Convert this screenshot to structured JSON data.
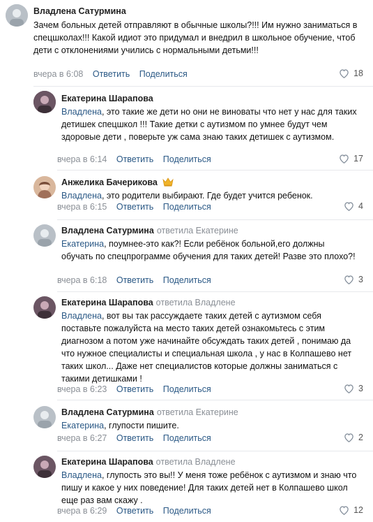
{
  "actions": {
    "reply": "Ответить",
    "share": "Поделиться"
  },
  "comments": [
    {
      "author": "Владлена Сатурмина",
      "reply_to": "",
      "mention": "",
      "text": "Зачем больных детей отправляют в обычные школы?!!! Им нужно заниматься в спецшколах!!! Какой идиот это придумал и внедрил в школьное обучение, чтоб дети с отклонениями учились с нормальными детьми!!!",
      "time": "вчера в 6:08",
      "likes": "18"
    },
    {
      "author": "Екатерина Шарапова",
      "reply_to": "",
      "mention": "Владлена",
      "text": ", это такие же дети но они не виноваты что нет у нас для таких детишек спецшкол !!! Такие детки с аутизмом по умнее будут чем здоровые дети , поверьте уж сама знаю таких детишек с аутизмом.",
      "time": "вчера в 6:14",
      "likes": "17"
    },
    {
      "author": "Анжелика Бачерикова",
      "reply_to": "",
      "mention": "Владлена",
      "text": ", это родители выбирают. Где будет учится ребенок.",
      "time": "вчера в 6:15",
      "likes": "4"
    },
    {
      "author": "Владлена Сатурмина",
      "reply_to": "ответила Екатерине",
      "mention": "Екатерина",
      "text": ", поумнее-это как?! Если ребёнок больной,его должны обучать по спецпрограмме обучения для таких детей! Разве это плохо?!",
      "time": "вчера в 6:18",
      "likes": "3"
    },
    {
      "author": "Екатерина Шарапова",
      "reply_to": "ответила Владлене",
      "mention": "Владлена",
      "text": ", вот вы так рассуждаете таких детей с аутизмом себя поставьте пожалуйста на место таких детей ознакомьтесь с этим диагнозом а потом уже начинайте обсуждать таких детей , понимаю да что нужное специалисты и специальная школа , у нас в Колпашево нет таких школ... Даже нет специалистов которые должны заниматься с такими детишками !",
      "time": "вчера в 6:23",
      "likes": "3"
    },
    {
      "author": "Владлена Сатурмина",
      "reply_to": "ответила Екатерине",
      "mention": "Екатерина",
      "text": ", глупости пишите.",
      "time": "вчера в 6:27",
      "likes": "2"
    },
    {
      "author": "Екатерина Шарапова",
      "reply_to": "ответила Владлене",
      "mention": "Владлена",
      "text": ", глупость это вы!! У меня тоже ребёнок с аутизмом и знаю что пишу и какое у них поведение! Для таких детей нет в Колпашево школ еще раз вам скажу .",
      "time": "вчера в 6:29",
      "likes": "12"
    }
  ]
}
